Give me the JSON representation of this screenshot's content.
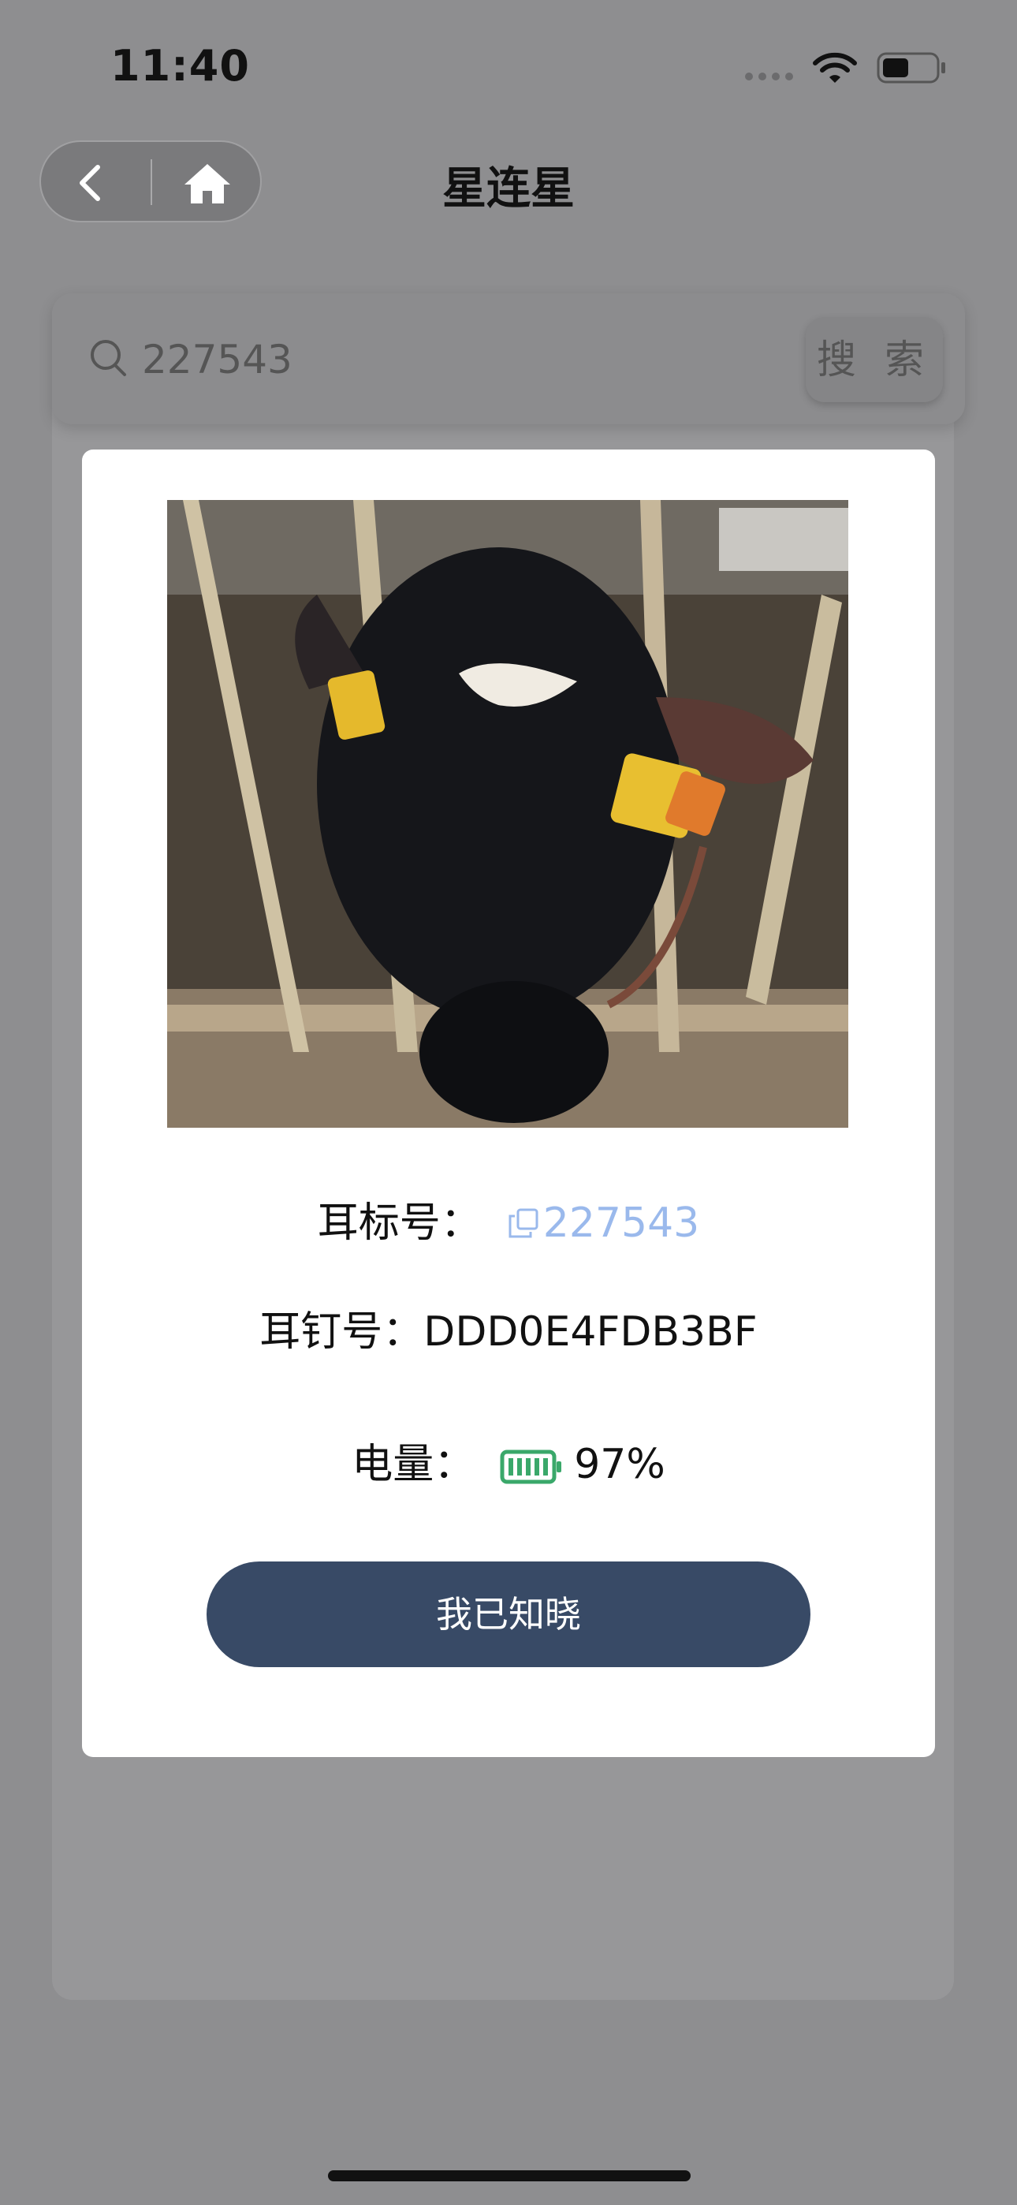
{
  "status_bar": {
    "time": "11:40",
    "signal_icon": "signal-dots-icon",
    "wifi_icon": "wifi-icon",
    "battery_icon": "battery-icon",
    "battery_level": 0.5
  },
  "nav": {
    "title": "星连星",
    "back_icon": "chevron-left-icon",
    "home_icon": "home-icon"
  },
  "search": {
    "icon": "search-icon",
    "value": "227543",
    "button_label": "搜 索"
  },
  "modal": {
    "photo_subject": "cow-photo",
    "ear_tag_label": "耳标号：",
    "ear_tag_value": "227543",
    "ear_nail_label": "耳钉号：",
    "ear_nail_value": "DDD0E4FDB3BF",
    "battery_label": "电量：",
    "battery_value": "97%",
    "battery_fraction": 0.97,
    "ack_button_label": "我已知晓"
  },
  "colors": {
    "overlay_bg": "#8e8e90",
    "link_blue": "#9ab9ec",
    "battery_green": "#3aa86a",
    "button_navy": "#384a66"
  }
}
